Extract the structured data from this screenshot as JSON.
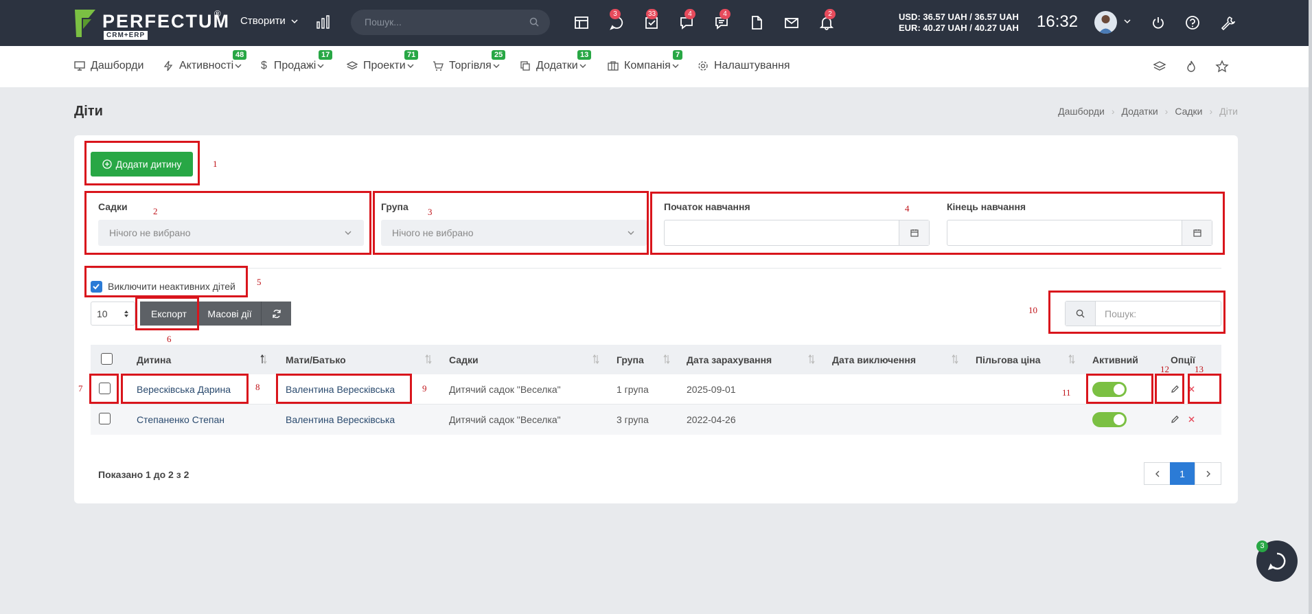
{
  "topbar": {
    "logo_text": "PERFECTUM",
    "logo_reg": "®",
    "logo_sub": "CRM+ERP",
    "create_label": "Створити",
    "search_placeholder": "Пошук...",
    "icons": [
      {
        "name": "calendar-board-icon",
        "badge": ""
      },
      {
        "name": "chat-bubble-icon",
        "badge": "3"
      },
      {
        "name": "task-check-icon",
        "badge": "33"
      },
      {
        "name": "messages-icon",
        "badge": "4"
      },
      {
        "name": "comments-icon",
        "badge": "4"
      },
      {
        "name": "document-icon",
        "badge": ""
      },
      {
        "name": "mail-icon",
        "badge": ""
      },
      {
        "name": "bell-icon",
        "badge": "2"
      }
    ],
    "currency_usd": "USD: 36.57 UAH / 36.57 UAH",
    "currency_eur": "EUR: 40.27 UAH / 40.27 UAH",
    "time": "16:32"
  },
  "nav": {
    "items": [
      {
        "label": "Дашборди",
        "badge": ""
      },
      {
        "label": "Активності",
        "badge": "48"
      },
      {
        "label": "Продажі",
        "badge": "17"
      },
      {
        "label": "Проекти",
        "badge": "71"
      },
      {
        "label": "Торгівля",
        "badge": "25"
      },
      {
        "label": "Додатки",
        "badge": "13"
      },
      {
        "label": "Компанія",
        "badge": "7"
      },
      {
        "label": "Налаштування",
        "badge": ""
      }
    ]
  },
  "page": {
    "title": "Діти",
    "breadcrumb": [
      "Дашборди",
      "Додатки",
      "Садки",
      "Діти"
    ]
  },
  "toolbar": {
    "add_label": "Додати дитину",
    "kindergartens_label": "Садки",
    "kindergartens_value": "Нічого не вибрано",
    "group_label": "Група",
    "group_value": "Нічого не вибрано",
    "start_label": "Початок навчання",
    "end_label": "Кінець навчання",
    "exclude_inactive_label": "Виключити неактивних дітей",
    "per_page": "10",
    "export_label": "Експорт",
    "bulk_label": "Масові дії",
    "search_placeholder": "Пошук:"
  },
  "table": {
    "headers": [
      "Дитина",
      "Мати/Батько",
      "Садки",
      "Група",
      "Дата зарахування",
      "Дата виключення",
      "Пільгова ціна",
      "Активний",
      "Опції"
    ],
    "rows": [
      {
        "child": "Вересківська Дарина",
        "parent": "Валентина Вересківська",
        "kindergarten": "Дитячий садок \"Веселка\"",
        "group": "1 група",
        "enrolled": "2025-09-01",
        "excluded": "",
        "discount": "",
        "active": true
      },
      {
        "child": "Степаненко Степан",
        "parent": "Валентина Вересківська",
        "kindergarten": "Дитячий садок \"Веселка\"",
        "group": "3 група",
        "enrolled": "2022-04-26",
        "excluded": "",
        "discount": "",
        "active": true
      }
    ],
    "shown_text": "Показано 1 до 2 з 2",
    "current_page": "1"
  },
  "annotations": [
    "1",
    "2",
    "3",
    "4",
    "5",
    "6",
    "7",
    "8",
    "9",
    "10",
    "11",
    "12",
    "13"
  ],
  "chat_badge": "3",
  "colors": {
    "topbar": "#2c3340",
    "accent_green": "#28a745",
    "badge_red": "#e64b5c",
    "primary_blue": "#2b7bd6",
    "annotation_red": "#d9151c"
  }
}
